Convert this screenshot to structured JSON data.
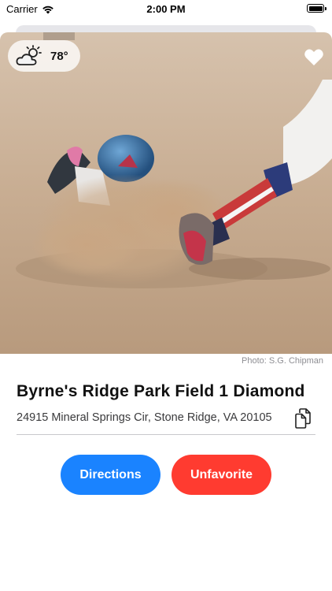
{
  "status_bar": {
    "carrier": "Carrier",
    "time": "2:00 PM",
    "battery_level": 1.0
  },
  "weather": {
    "icon": "partly-sunny-icon",
    "temperature": "78°"
  },
  "favorite": {
    "icon": "heart-filled-icon",
    "color": "#ffffff"
  },
  "photo": {
    "subject": "baseball-slide-photo",
    "credit": "Photo: S.G. Chipman"
  },
  "park": {
    "name": "Byrne's Ridge Park Field 1 Diamond",
    "address": "24915 Mineral Springs Cir, Stone Ridge, VA 20105",
    "copy_icon": "copy-icon"
  },
  "actions": {
    "directions_label": "Directions",
    "unfavorite_label": "Unfavorite",
    "directions_color": "#1a83ff",
    "unfavorite_color": "#ff3b30"
  }
}
